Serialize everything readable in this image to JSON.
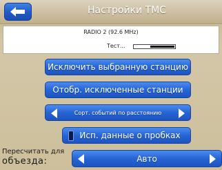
{
  "header": {
    "title": "Настройки TMC",
    "back_icon": "arrow-left-icon"
  },
  "station": {
    "name": "RADIO 2 (92.6 MHz)",
    "test_label": "Тест...",
    "signal_level_fraction": 0.6
  },
  "buttons": {
    "exclude_station": "Исключить выбранную станцию",
    "show_excluded": "Отобр. исключенные станции",
    "use_traffic": "Исп. данные о пробках"
  },
  "sort_selector": {
    "value": "Сорт. событий по расстоянию",
    "prev_icon": "triangle-left-icon",
    "next_icon": "triangle-right-icon"
  },
  "recalc": {
    "label_line1": "Пересчитать для",
    "label_line2": "объезда:",
    "value": "Авто"
  },
  "colors": {
    "accent_blue": "#2764d4",
    "background": "#cdbf9b"
  }
}
